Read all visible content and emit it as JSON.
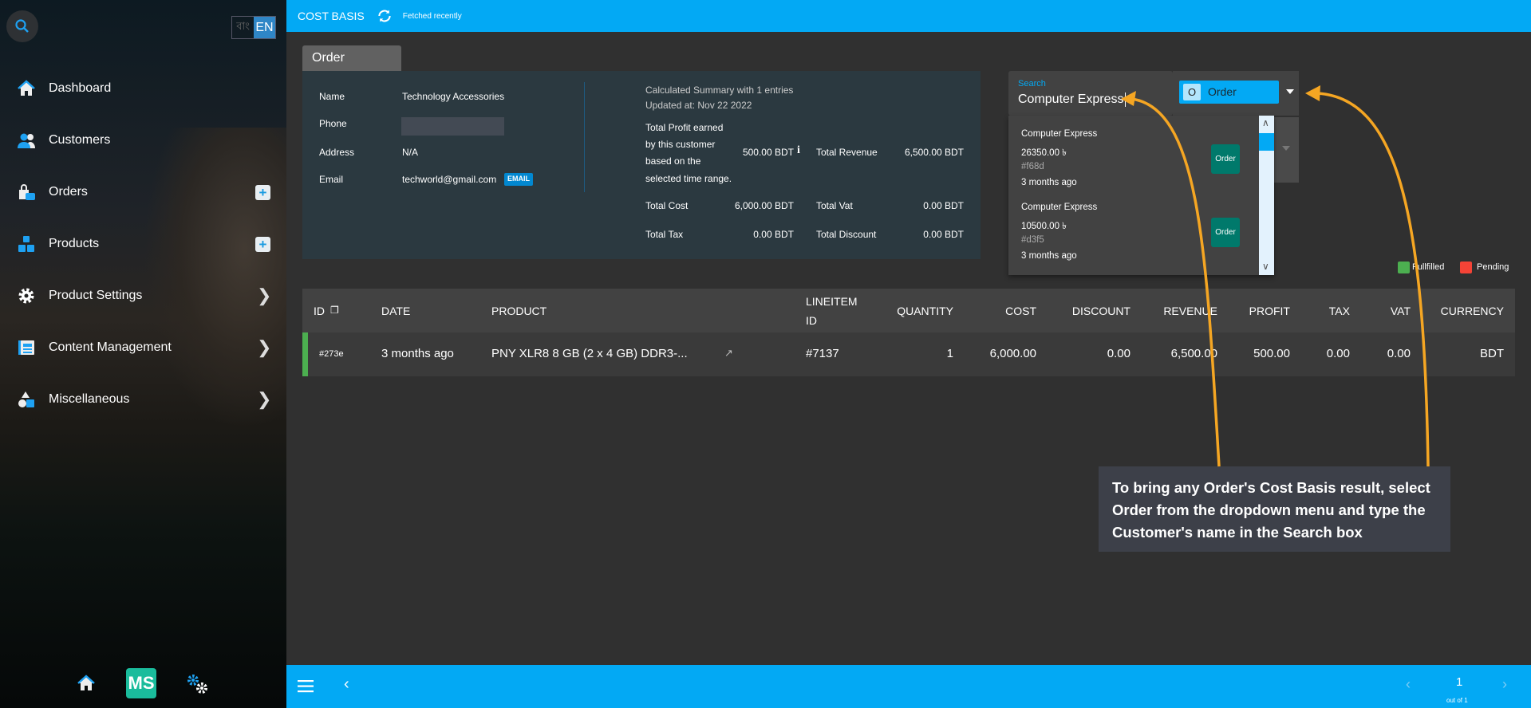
{
  "sidebar": {
    "lang": {
      "bn": "বাং",
      "en": "EN"
    },
    "items": [
      {
        "label": "Dashboard",
        "icon": "home-icon"
      },
      {
        "label": "Customers",
        "icon": "users-icon"
      },
      {
        "label": "Orders",
        "icon": "shopping-bag-icon",
        "action": "plus"
      },
      {
        "label": "Products",
        "icon": "boxes-icon",
        "action": "plus"
      },
      {
        "label": "Product Settings",
        "icon": "gear-icon",
        "action": "chevron"
      },
      {
        "label": "Content Management",
        "icon": "newspaper-icon",
        "action": "chevron"
      },
      {
        "label": "Miscellaneous",
        "icon": "shapes-icon",
        "action": "chevron"
      }
    ],
    "logo": "MS"
  },
  "header": {
    "title": "COST BASIS",
    "status": "Fetched recently"
  },
  "tab": "Order",
  "summary": {
    "name_label": "Name",
    "name": "Technology Accessories",
    "phone_label": "Phone",
    "address_label": "Address",
    "address": "N/A",
    "email_label": "Email",
    "email": "techworld@gmail.com",
    "email_badge": "EMAIL",
    "calc": "Calculated Summary with 1 entries",
    "updated": "Updated at: Nov 22 2022",
    "profit_label": [
      "Total Profit earned",
      "by this customer",
      "based on the",
      "selected time range."
    ],
    "profit": "500.00 BDT",
    "revenue_label": "Total Revenue",
    "revenue": "6,500.00 BDT",
    "cost_label": "Total Cost",
    "cost": "6,000.00 BDT",
    "vat_label": "Total Vat",
    "vat": "0.00 BDT",
    "tax_label": "Total Tax",
    "tax": "0.00 BDT",
    "discount_label": "Total Discount",
    "discount": "0.00 BDT"
  },
  "search": {
    "label": "Search",
    "value": "Computer Express",
    "type_letter": "O",
    "type": "Order",
    "results": [
      {
        "name": "Computer Express",
        "amount": "26350.00 ৳",
        "id": "#f68d",
        "time": "3 months ago",
        "button": "Order"
      },
      {
        "name": "Computer Express",
        "amount": "10500.00 ৳",
        "id": "#d3f5",
        "time": "3 months ago",
        "button": "Order"
      }
    ]
  },
  "legend": {
    "fulfilled": "Fullfilled",
    "pending": "Pending",
    "fulfilled_color": "#4caf50",
    "pending_color": "#f44336"
  },
  "table": {
    "headers": [
      "ID",
      "DATE",
      "PRODUCT",
      "LINEITEM",
      "ID",
      "QUANTITY",
      "COST",
      "DISCOUNT",
      "REVENUE",
      "PROFIT",
      "TAX",
      "VAT",
      "CURRENCY"
    ],
    "row": {
      "id": "#273e",
      "date": "3 months ago",
      "product": "PNY XLR8 8 GB (2 x 4 GB) DDR3-...",
      "lineitem": "#7137",
      "quantity": "1",
      "cost": "6,000.00",
      "discount": "0.00",
      "revenue": "6,500.00",
      "profit": "500.00",
      "tax": "0.00",
      "vat": "0.00",
      "currency": "BDT"
    }
  },
  "pagination": {
    "page": "1",
    "of": "out of 1"
  },
  "annotation": "To bring any Order's Cost Basis result, select Order from the dropdown menu and type the Customer's name in the Search box"
}
